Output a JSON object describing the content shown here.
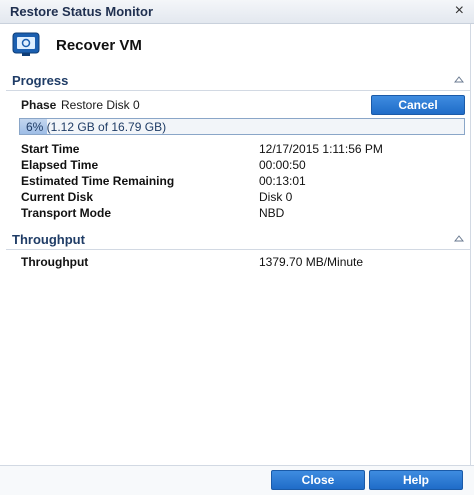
{
  "window": {
    "title": "Restore Status Monitor"
  },
  "header": {
    "title": "Recover VM",
    "icon": "monitor-icon"
  },
  "progress_section": {
    "title": "Progress",
    "phase_label": "Phase",
    "phase_value": "Restore Disk 0",
    "cancel_label": "Cancel",
    "progress_text": "6% (1.12 GB of 16.79 GB)",
    "progress_percent": 6,
    "rows": [
      {
        "label": "Start Time",
        "value": "12/17/2015 1:11:56 PM"
      },
      {
        "label": "Elapsed Time",
        "value": "00:00:50"
      },
      {
        "label": "Estimated Time Remaining",
        "value": "00:13:01"
      },
      {
        "label": "Current Disk",
        "value": "Disk 0"
      },
      {
        "label": "Transport Mode",
        "value": "NBD"
      }
    ]
  },
  "throughput_section": {
    "title": "Throughput",
    "rows": [
      {
        "label": "Throughput",
        "value": "1379.70 MB/Minute"
      }
    ]
  },
  "footer": {
    "close_label": "Close",
    "help_label": "Help"
  },
  "colors": {
    "accent": "#1f6cc8",
    "section_title": "#1f3c66"
  }
}
